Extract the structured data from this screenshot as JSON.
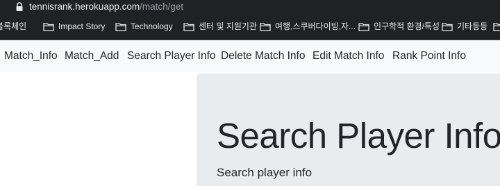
{
  "browser": {
    "url_domain": "tennisrank.herokuapp.com",
    "url_path": "/match/get",
    "bookmarks": [
      {
        "label": "블록체인",
        "icon": "folder-icon"
      },
      {
        "label": "Impact Story",
        "icon": "folder-icon"
      },
      {
        "label": "Technology",
        "icon": "folder-icon"
      },
      {
        "label": "센터 및 지원기관",
        "icon": "folder-icon"
      },
      {
        "label": "여행,스쿠버다이빙,자...",
        "icon": "folder-icon"
      },
      {
        "label": "인구학적 환경/특성",
        "icon": "folder-icon"
      },
      {
        "label": "기타등등",
        "icon": "folder-icon"
      }
    ]
  },
  "nav": {
    "items": [
      {
        "label": "Match_Info"
      },
      {
        "label": "Match_Add"
      },
      {
        "label": "Search Player Info"
      },
      {
        "label": "Delete Match Info"
      },
      {
        "label": "Edit Match Info"
      },
      {
        "label": "Rank Point Info"
      }
    ]
  },
  "main": {
    "title": "Search Player Info",
    "lead": "Search player info"
  },
  "colors": {
    "chrome_bg": "#202124",
    "navbar_bg": "#f8f9fa",
    "jumbotron_bg": "#e9ecef",
    "text": "#212529"
  }
}
